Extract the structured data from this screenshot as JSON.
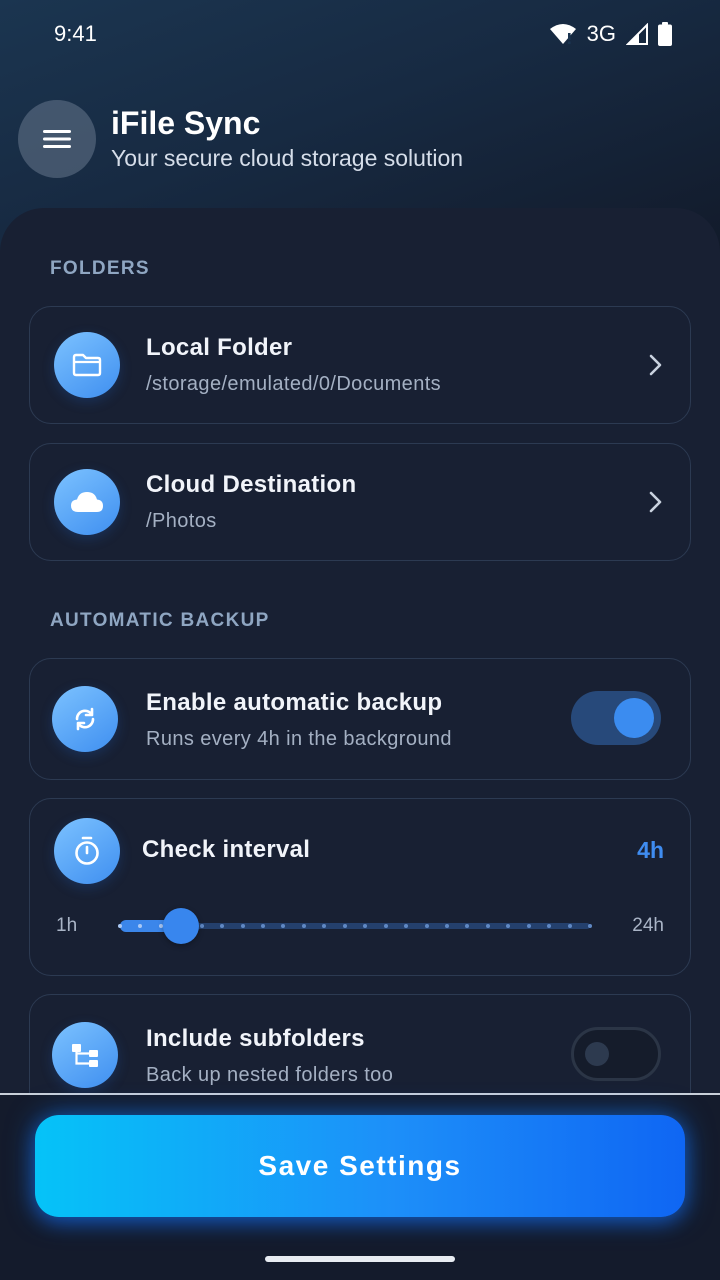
{
  "status_bar": {
    "time": "9:41",
    "network": "3G"
  },
  "header": {
    "title": "iFile Sync",
    "subtitle": "Your secure cloud storage solution",
    "menu_icon": "hamburger-menu-icon"
  },
  "sections": {
    "folders": "FOLDERS",
    "automatic_backup": "AUTOMATIC BACKUP"
  },
  "local_folder": {
    "title": "Local Folder",
    "path": "/storage/emulated/0/Documents",
    "icon": "folder-icon"
  },
  "cloud_destination": {
    "title": "Cloud Destination",
    "path": "/Photos",
    "icon": "cloud-icon"
  },
  "auto_backup": {
    "title": "Enable automatic backup",
    "subtitle": "Runs every 4h in the background",
    "enabled": true,
    "icon": "sync-icon"
  },
  "check_interval": {
    "title": "Check interval",
    "value_label": "4h",
    "min_label": "1h",
    "max_label": "24h",
    "min": 1,
    "max": 24,
    "value": 4,
    "icon": "timer-icon"
  },
  "include_subfolders": {
    "title": "Include subfolders",
    "subtitle": "Back up nested folders too",
    "enabled": false,
    "icon": "folder-tree-icon"
  },
  "save_button": {
    "label": "Save Settings"
  },
  "colors": {
    "accent": "#3b86ea",
    "background": "#141b2c",
    "card": "#182033",
    "button_start": "#05c3f8",
    "button_end": "#0f66f3"
  }
}
